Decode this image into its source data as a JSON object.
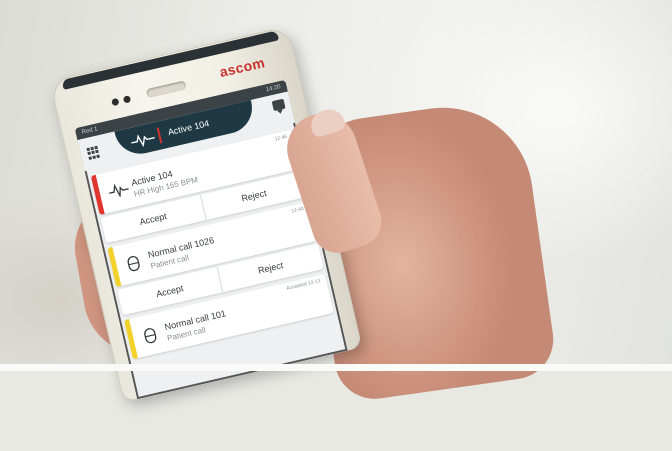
{
  "device": {
    "brand_logo": "ascom",
    "status_left": "Red 1",
    "status_right": "14:20",
    "header_tab_label": "Active 104"
  },
  "notifications": [
    {
      "title": "Active 104",
      "subtitle": "HR High 165 BPM",
      "time": "12:46",
      "priority_color": "#e0342f",
      "icon": "heartbeat-icon"
    },
    {
      "title": "Normal call 1026",
      "subtitle": "Patient call",
      "time": "12:40",
      "priority_color": "#f2d129",
      "icon": "call-button-icon"
    },
    {
      "title": "Normal call 101",
      "subtitle": "Patient call",
      "time": "Accepted 12:13",
      "priority_color": "#f2d129",
      "icon": "call-button-icon"
    }
  ],
  "actions": {
    "accept_label": "Accept",
    "reject_label": "Reject"
  },
  "colors": {
    "header_dark": "#1f3944",
    "alarm_red": "#e0342f",
    "normal_yellow": "#f2d129",
    "logo_red": "#c8322e"
  }
}
